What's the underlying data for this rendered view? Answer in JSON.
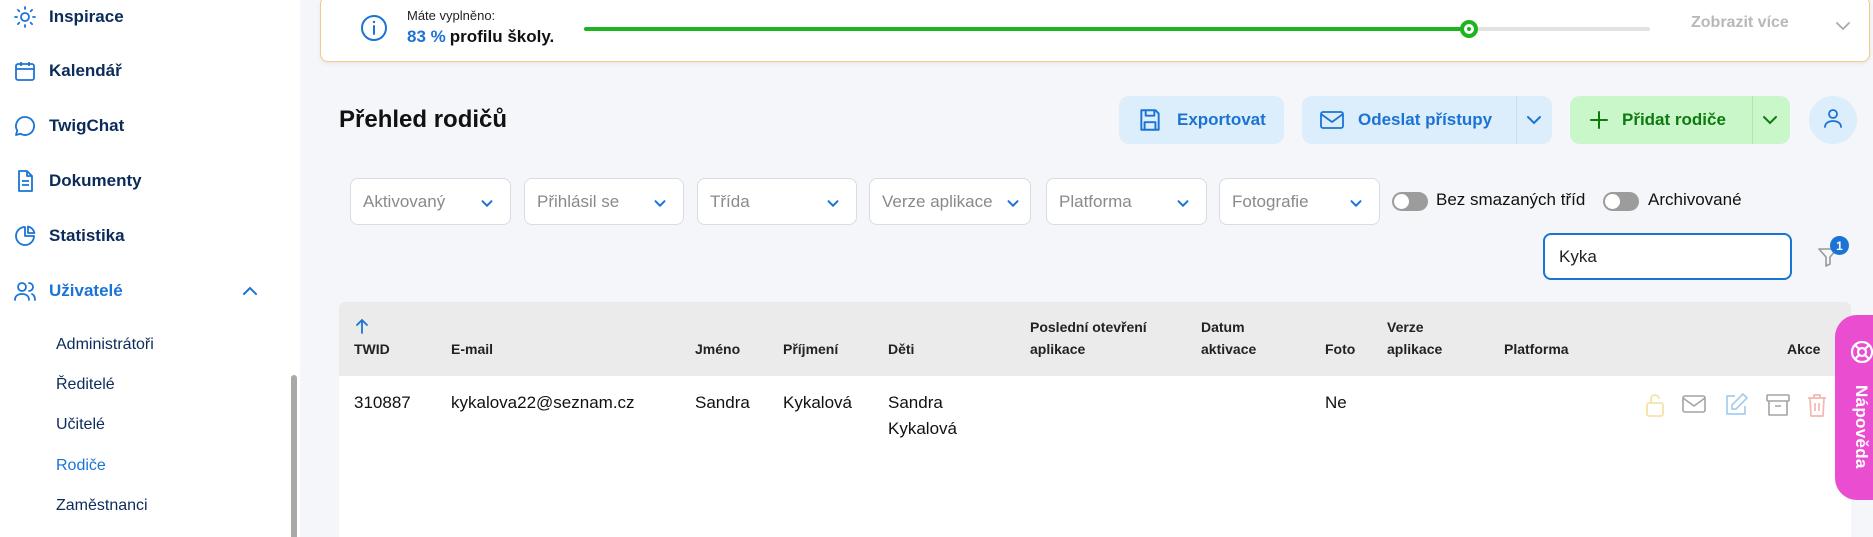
{
  "sidebar": {
    "items": [
      {
        "label": "Inspirace",
        "icon": "sun-icon"
      },
      {
        "label": "Kalendář",
        "icon": "calendar-icon"
      },
      {
        "label": "TwigChat",
        "icon": "chat-icon"
      },
      {
        "label": "Dokumenty",
        "icon": "document-icon"
      },
      {
        "label": "Statistika",
        "icon": "pie-chart-icon"
      },
      {
        "label": "Uživatelé",
        "icon": "users-icon",
        "expanded": true
      }
    ],
    "subitems": [
      {
        "label": "Administrátoři"
      },
      {
        "label": "Ředitelé"
      },
      {
        "label": "Učitelé"
      },
      {
        "label": "Rodiče",
        "active": true
      },
      {
        "label": "Zaměstnanci"
      }
    ]
  },
  "banner": {
    "title": "Máte vyplněno:",
    "percent": "83 %",
    "percent_value": 0.83,
    "suffix": "profilu školy.",
    "more": "Zobrazit více"
  },
  "header": {
    "title": "Přehled rodičů",
    "export_label": "Exportovat",
    "send_label": "Odeslat přístupy",
    "add_label": "Přidat rodiče"
  },
  "filters": {
    "dropdowns": [
      "Aktivovaný",
      "Přihlásil se",
      "Třída",
      "Verze aplikace",
      "Platforma",
      "Fotografie"
    ],
    "toggles": [
      "Bez smazaných tříd",
      "Archivované"
    ],
    "search_value": "Kyka",
    "active_filter_count": "1"
  },
  "table": {
    "columns": {
      "twid": "TWID",
      "email": "E-mail",
      "first": "Jméno",
      "last": "Příjmení",
      "children": "Děti",
      "last_open_1": "Poslední otevření",
      "last_open_2": "aplikace",
      "activation_1": "Datum",
      "activation_2": "aktivace",
      "photo": "Foto",
      "version_1": "Verze",
      "version_2": "aplikace",
      "platform": "Platforma",
      "actions": "Akce"
    },
    "rows": [
      {
        "twid": "310887",
        "email": "kykalova22@seznam.cz",
        "first": "Sandra",
        "last": "Kykalová",
        "children_1": "Sandra",
        "children_2": "Kykalová",
        "photo": "Ne"
      }
    ],
    "row_action_icons": [
      "lock-icon",
      "mail-icon",
      "edit-icon",
      "archive-icon",
      "trash-icon"
    ]
  },
  "help": {
    "label": "Nápověda"
  },
  "colors": {
    "accent": "#1b74d4",
    "success": "#1fb31f",
    "help": "#e94ed0",
    "banner_border": "#f4c98a"
  }
}
